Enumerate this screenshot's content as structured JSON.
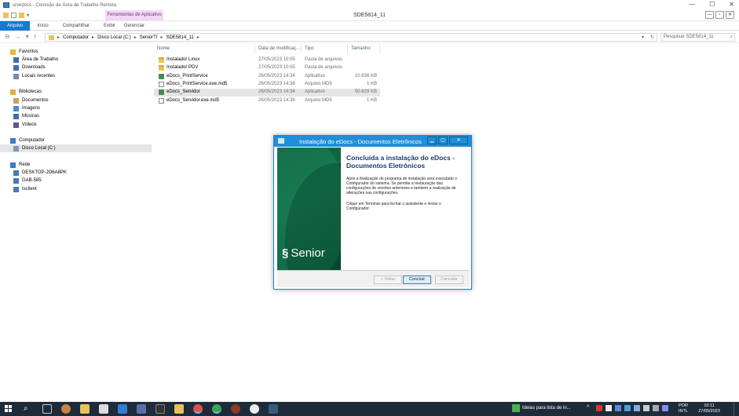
{
  "rdp": {
    "title": "srvedocs - Conexão de Área de Trabalho Remota",
    "ctrl_min": "—",
    "ctrl_max": "☐",
    "ctrl_close": "✕"
  },
  "explorer": {
    "window_title": "SDE5814_11",
    "context_tab": "Ferramentas de Aplicativo",
    "ribbon_tabs": [
      "Arquivo",
      "Início",
      "Compartilhar",
      "Exibir"
    ],
    "manage_tab": "Gerenciar",
    "breadcrumb": [
      "Computador",
      "Disco Local (C:)",
      "SeniorTI",
      "SDE5814_11"
    ],
    "search_placeholder": "Pesquisar SDE5814_11",
    "nav_items": [
      {
        "label": "Favoritos",
        "icon": "star-icon",
        "color": "#e8b83a"
      },
      {
        "label": "Área de Trabalho",
        "icon": "desktop-icon",
        "color": "#3a6fb8"
      },
      {
        "label": "Downloads",
        "icon": "downloads-icon",
        "color": "#3a6fb8"
      },
      {
        "label": "Locais recentes",
        "icon": "recent-places-icon",
        "color": "#7a8aa0"
      },
      {
        "label": "Bibliotecas",
        "icon": "libraries-icon",
        "color": "#d9b24a"
      },
      {
        "label": "Documentos",
        "icon": "documents-icon",
        "color": "#c9a35a"
      },
      {
        "label": "Imagens",
        "icon": "pictures-icon",
        "color": "#4a90c8"
      },
      {
        "label": "Músicas",
        "icon": "music-icon",
        "color": "#3a6fb8"
      },
      {
        "label": "Vídeos",
        "icon": "videos-icon",
        "color": "#5a5a8a"
      },
      {
        "label": "Computador",
        "icon": "computer-icon",
        "color": "#4a7ab8"
      },
      {
        "label": "Disco Local (C:)",
        "icon": "local-disk-icon",
        "color": "#7a9ab8"
      },
      {
        "label": "Rede",
        "icon": "network-icon",
        "color": "#3a7ab8"
      },
      {
        "label": "DESKTOP-JO6A8PK",
        "icon": "network-pc-icon",
        "color": "#4a7ab8"
      },
      {
        "label": "GAB-585",
        "icon": "network-pc-icon",
        "color": "#4a7ab8"
      },
      {
        "label": "tsclient",
        "icon": "network-pc-icon",
        "color": "#4a7ab8"
      }
    ],
    "columns": [
      "Nome",
      "Data de modificaç...",
      "Tipo",
      "Tamanho"
    ],
    "files": [
      {
        "name": "Instalador Linux",
        "date": "27/05/2023 10:05",
        "type": "Pasta de arquivos",
        "size": "",
        "kind": "folder"
      },
      {
        "name": "Instalador PDV",
        "date": "27/05/2023 10:05",
        "type": "Pasta de arquivos",
        "size": "",
        "kind": "folder"
      },
      {
        "name": "eDocs_PrintService",
        "date": "26/05/2023 14:34",
        "type": "Aplicativo",
        "size": "10.836 KB",
        "kind": "app"
      },
      {
        "name": "eDocs_PrintService.exe.md5",
        "date": "26/05/2023 14:36",
        "type": "Arquivo MD5",
        "size": "1 KB",
        "kind": "doc"
      },
      {
        "name": "eDocs_Servidor",
        "date": "26/05/2023 14:34",
        "type": "Aplicativo",
        "size": "50.829 KB",
        "kind": "app"
      },
      {
        "name": "eDocs_Servidor.exe.md5",
        "date": "26/05/2023 14:36",
        "type": "Arquivo MD5",
        "size": "1 KB",
        "kind": "doc"
      }
    ]
  },
  "dialog": {
    "title": "Instalação do eDocs - Documentos Eletrônicos",
    "heading": "Concluída a instalação do eDocs - Documentos Eletrônicos",
    "paragraph1": "Após a finalização do programa de instalação será executado o Configurador do sistema. Se permite a restauração das configurações de versões anteriores e também a realização de alterações nas configurações.",
    "paragraph2": "Clique em Terminar para fechar o assistente e iniciar o Configurador.",
    "brand": "Senior",
    "btn_back": "< Voltar",
    "btn_finish": "Concluir",
    "btn_cancel": "Cancelar"
  },
  "taskbar": {
    "notification": "Ideias para lista de in...",
    "lang1": "POR",
    "lang2": "INTL",
    "time": "10:11",
    "date": "27/05/2023"
  }
}
